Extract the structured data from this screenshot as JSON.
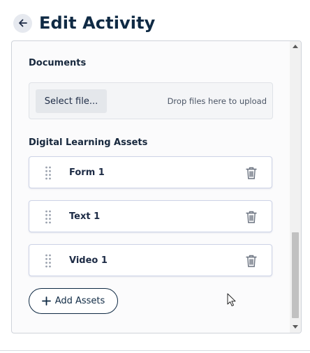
{
  "header": {
    "title": "Edit Activity",
    "back_icon": "arrow-left-icon"
  },
  "documents": {
    "label": "Documents",
    "select_button": "Select file...",
    "drop_hint": "Drop files here to upload"
  },
  "assets": {
    "label": "Digital Learning Assets",
    "items": [
      {
        "name": "Form 1",
        "handle_icon": "drag-handle-icon",
        "delete_icon": "trash-icon"
      },
      {
        "name": "Text 1",
        "handle_icon": "drag-handle-icon",
        "delete_icon": "trash-icon"
      },
      {
        "name": "Video 1",
        "handle_icon": "drag-handle-icon",
        "delete_icon": "trash-icon"
      }
    ],
    "add_button": "Add Assets"
  },
  "colors": {
    "title": "#0f2a44",
    "card_border": "#cdd3e6",
    "back_button_bg": "#e6e9ef"
  }
}
